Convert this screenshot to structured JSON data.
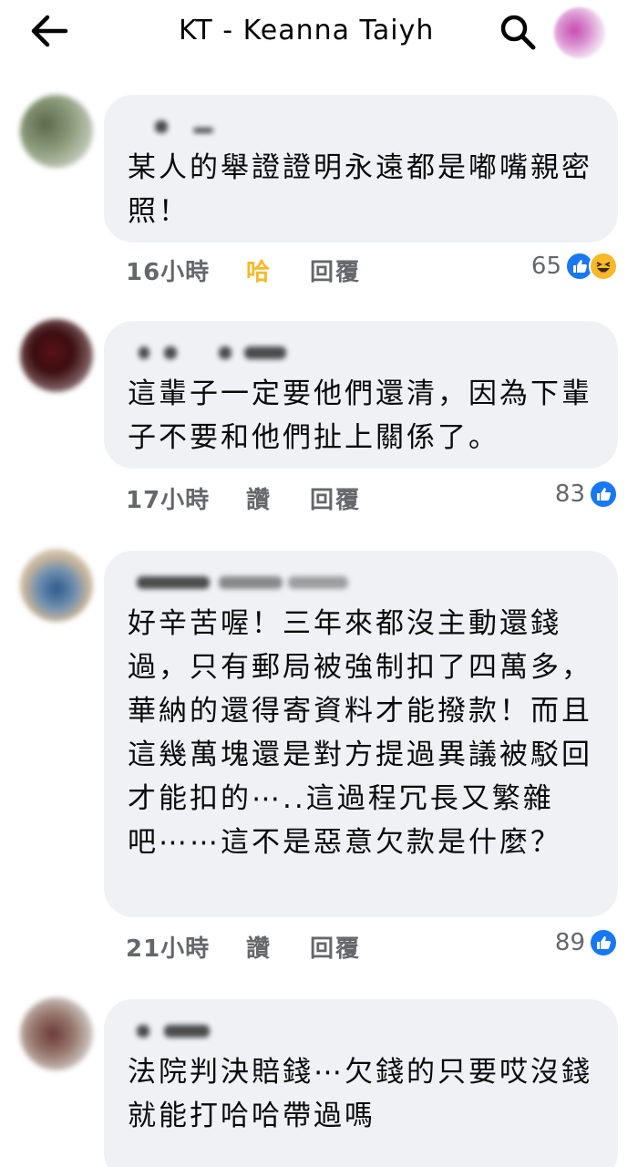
{
  "header": {
    "title": "KT - Keanna Taiyh",
    "back_icon": "arrow-left-icon",
    "search_icon": "search-icon"
  },
  "colors": {
    "bubble": "#eff1f4",
    "meta_text": "#65676b",
    "like_blue": "#1877f2",
    "haha_yellow": "#f7b928"
  },
  "comments": [
    {
      "text": "某人的舉證證明永遠都是嘟嘴親密照！",
      "time": "16小時",
      "reaction_label": "哈",
      "reply_label": "回覆",
      "count": "65",
      "reactions": [
        "like",
        "haha"
      ]
    },
    {
      "text": "這輩子一定要他們還清，因為下輩子不要和他們扯上關係了。",
      "time": "17小時",
      "reaction_label": "讚",
      "reply_label": "回覆",
      "count": "83",
      "reactions": [
        "like"
      ]
    },
    {
      "text": "好辛苦喔！三年來都沒主動還錢過，只有郵局被強制扣了四萬多，華納的還得寄資料才能撥款！而且這幾萬塊還是對方提過異議被駁回才能扣的⋯..這過程冗長又繁雜吧⋯⋯這不是惡意欠款是什麼？",
      "time": "21小時",
      "reaction_label": "讚",
      "reply_label": "回覆",
      "count": "89",
      "reactions": [
        "like"
      ]
    },
    {
      "text": "法院判決賠錢⋯欠錢的只要哎沒錢 就能打哈哈帶過嗎",
      "time": "",
      "reaction_label": "",
      "reply_label": "",
      "count": "",
      "reactions": []
    }
  ]
}
